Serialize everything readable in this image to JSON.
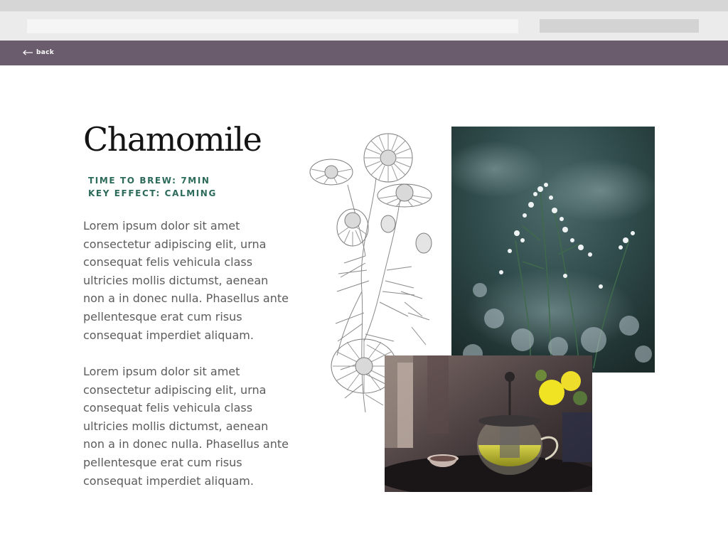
{
  "nav": {
    "back_label": "back"
  },
  "tea": {
    "name": "Chamomile",
    "brew_time": "TIME TO BREW: 7MIN",
    "key_effect": "KEY EFFECT: CALMING",
    "paragraphs": [
      "Lorem ipsum dolor sit amet consectetur adipiscing elit, urna consequat felis vehicula class ultricies mollis dictumst, aenean non a in donec nulla. Phasellus ante pellentesque erat cum risus consequat imperdiet aliquam.",
      "Lorem ipsum dolor sit amet consectetur adipiscing elit, urna consequat felis vehicula class ultricies mollis dictumst, aenean non a in donec nulla. Phasellus ante pellentesque erat cum risus consequat imperdiet aliquam."
    ]
  },
  "icons": {
    "back": "arrow-left-icon"
  },
  "colors": {
    "navbar": "#6a5c6c",
    "meta_text": "#2c6a5a",
    "body_text": "#5c5c5c",
    "title_text": "#141414"
  }
}
